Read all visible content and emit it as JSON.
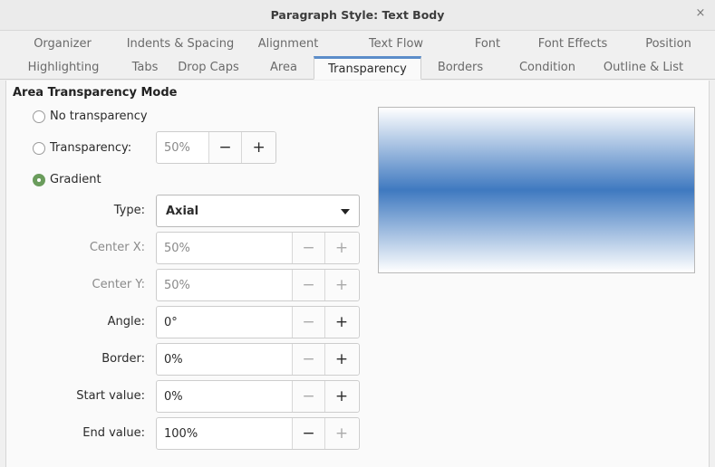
{
  "window": {
    "title": "Paragraph Style: Text Body",
    "close_glyph": "×"
  },
  "tabs_row1": [
    "Organizer",
    "Indents & Spacing",
    "Alignment",
    "Text Flow",
    "Font",
    "Font Effects",
    "Position"
  ],
  "tabs_row2": [
    "Highlighting",
    "Tabs",
    "Drop Caps",
    "Area",
    "Transparency",
    "Borders",
    "Condition",
    "Outline & List"
  ],
  "active_tab": "Transparency",
  "section": {
    "title": "Area Transparency Mode"
  },
  "modes": {
    "none": {
      "label": "No transparency",
      "selected": false
    },
    "transparency": {
      "label": "Transparency:",
      "selected": false,
      "value": "50%"
    },
    "gradient": {
      "label": "Gradient",
      "selected": true
    }
  },
  "gradient": {
    "type": {
      "label": "Type:",
      "value": "Axial"
    },
    "center_x": {
      "label": "Center X:",
      "value": "50%"
    },
    "center_y": {
      "label": "Center Y:",
      "value": "50%"
    },
    "angle": {
      "label": "Angle:",
      "value": "0°"
    },
    "border": {
      "label": "Border:",
      "value": "0%"
    },
    "start_value": {
      "label": "Start value:",
      "value": "0%"
    },
    "end_value": {
      "label": "End value:",
      "value": "100%"
    }
  },
  "spin_glyphs": {
    "minus": "−",
    "plus": "+"
  },
  "colors": {
    "accent": "#5b8dc9",
    "radio_selected": "#6a9c5c",
    "gradient_mid": "#3f79c0"
  }
}
